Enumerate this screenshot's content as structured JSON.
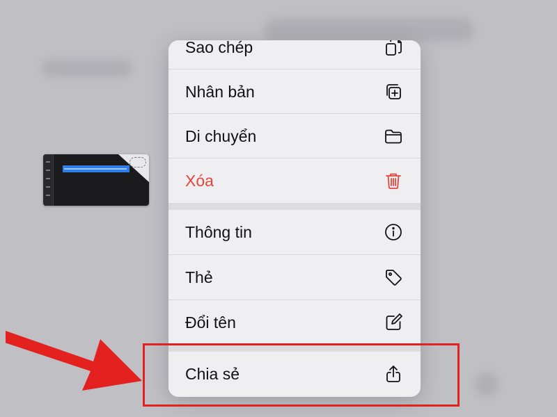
{
  "menu": {
    "items": [
      {
        "label": "Sao chép",
        "icon": "copy-icon"
      },
      {
        "label": "Nhân bản",
        "icon": "duplicate-icon"
      },
      {
        "label": "Di chuyển",
        "icon": "folder-icon"
      },
      {
        "label": "Xóa",
        "icon": "trash-icon",
        "destructive": true
      },
      {
        "label": "Thông tin",
        "icon": "info-icon"
      },
      {
        "label": "Thẻ",
        "icon": "tag-icon"
      },
      {
        "label": "Đổi tên",
        "icon": "rename-icon"
      },
      {
        "label": "Chia sẻ",
        "icon": "share-icon"
      }
    ]
  },
  "colors": {
    "destructive": "#e5453a",
    "highlight": "#e3211f",
    "arrow": "#e3211f"
  }
}
